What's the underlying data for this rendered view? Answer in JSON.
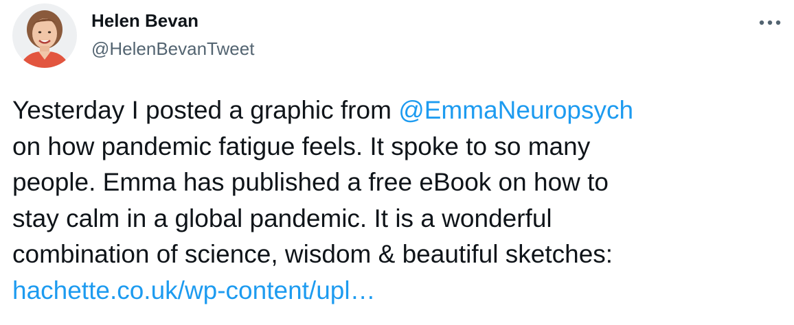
{
  "author": {
    "name": "Helen Bevan",
    "handle": "@HelenBevanTweet",
    "avatar_icon": "profile-photo"
  },
  "menu": {
    "icon": "more-horizontal-icon"
  },
  "tweet": {
    "line1_text": "Yesterday I posted a graphic from ",
    "mention": "@EmmaNeuropsych",
    "line2": "on how pandemic fatigue feels. It spoke to so many",
    "line3": "people. Emma has published a free eBook on how to",
    "line4": "stay calm in a global pandemic. It is a wonderful",
    "line5": "combination of science, wisdom & beautiful sketches:",
    "link": "hachette.co.uk/wp-content/upl…"
  },
  "colors": {
    "link": "#1d9bf0",
    "text": "#0f1419",
    "secondary": "#536471"
  }
}
